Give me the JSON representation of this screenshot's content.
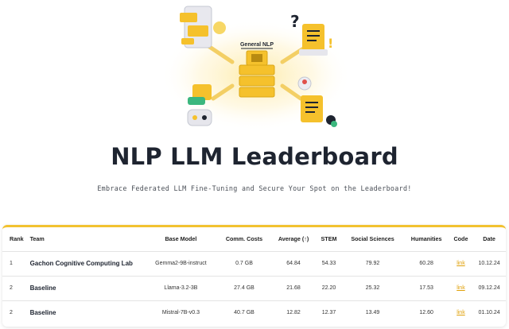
{
  "hero": {
    "badge_text": "General NLP"
  },
  "header": {
    "title": "NLP LLM Leaderboard",
    "subtitle": "Embrace Federated LLM Fine-Tuning and Secure Your Spot on the Leaderboard!"
  },
  "colors": {
    "accent": "#f2c230",
    "link": "#e0a10a",
    "title": "#1e2430"
  },
  "table": {
    "columns": [
      "Rank",
      "Team",
      "Base Model",
      "Comm. Costs",
      "Average (↑)",
      "STEM",
      "Social Sciences",
      "Humanities",
      "Code",
      "Date"
    ],
    "rows": [
      {
        "rank": "1",
        "team": "Gachon Cognitive Computing Lab",
        "base_model": "Gemma2-9B-instruct",
        "comm_costs": "0.7 GB",
        "average": "64.84",
        "stem": "54.33",
        "social_sciences": "79.92",
        "humanities": "60.28",
        "code": "link",
        "date": "10.12.24"
      },
      {
        "rank": "2",
        "team": "Baseline",
        "base_model": "Llama-3.2-3B",
        "comm_costs": "27.4 GB",
        "average": "21.68",
        "stem": "22.20",
        "social_sciences": "25.32",
        "humanities": "17.53",
        "code": "link",
        "date": "09.12.24"
      },
      {
        "rank": "2",
        "team": "Baseline",
        "base_model": "Mistral-7B-v0.3",
        "comm_costs": "40.7 GB",
        "average": "12.82",
        "stem": "12.37",
        "social_sciences": "13.49",
        "humanities": "12.60",
        "code": "link",
        "date": "01.10.24"
      }
    ]
  }
}
